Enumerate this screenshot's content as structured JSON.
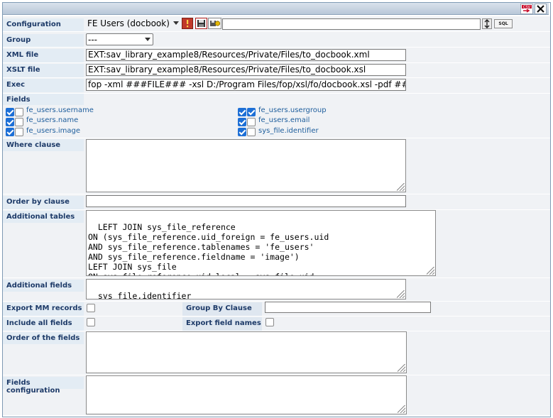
{
  "toolbar": {
    "csv_label": "CSV",
    "sql_label": "SQL"
  },
  "form": {
    "configuration": {
      "label": "Configuration",
      "value": "FE Users (docbook)",
      "name_value": ""
    },
    "group": {
      "label": "Group",
      "value": "---"
    },
    "xml_file": {
      "label": "XML file",
      "value": "EXT:sav_library_example8/Resources/Private/Files/to_docbook.xml"
    },
    "xslt_file": {
      "label": "XSLT file",
      "value": "EXT:sav_library_example8/Resources/Private/Files/to_docbook.xsl"
    },
    "exec": {
      "label": "Exec",
      "value": "fop -xml ###FILE### -xsl D:/Program Files/fop/xsl/fo/docbook.xsl -pdf ###SITE"
    },
    "fields": {
      "label": "Fields",
      "left": [
        {
          "name": "fe_users.username",
          "checked1": true,
          "checked2": false
        },
        {
          "name": "fe_users.name",
          "checked1": true,
          "checked2": false
        },
        {
          "name": "fe_users.image",
          "checked1": true,
          "checked2": false
        }
      ],
      "right": [
        {
          "name": "fe_users.usergroup",
          "checked1": true,
          "checked2": true
        },
        {
          "name": "fe_users.email",
          "checked1": true,
          "checked2": false
        },
        {
          "name": "sys_file.identifier",
          "checked1": true,
          "checked2": false
        }
      ]
    },
    "where_clause": {
      "label": "Where clause",
      "value": ""
    },
    "order_by_clause": {
      "label": "Order by clause",
      "value": ""
    },
    "additional_tables": {
      "label": "Additional tables",
      "value": "LEFT JOIN sys_file_reference\nON (sys_file_reference.uid_foreign = fe_users.uid\nAND sys_file_reference.tablenames = 'fe_users'\nAND sys_file_reference.fieldname = 'image')\nLEFT JOIN sys_file\nON sys_file_reference.uid_local = sys_file.uid"
    },
    "additional_fields": {
      "label": "Additional fields",
      "value": "sys_file.identifier"
    },
    "export_mm_records": {
      "label": "Export MM records",
      "checked": false
    },
    "group_by_clause": {
      "label": "Group By Clause",
      "value": ""
    },
    "include_all_fields": {
      "label": "Include all fields",
      "checked": false
    },
    "export_field_names": {
      "label": "Export field names",
      "checked": false
    },
    "order_of_fields": {
      "label": "Order of the fields",
      "value": ""
    },
    "fields_configuration": {
      "label": "Fields configuration",
      "value": ""
    }
  }
}
